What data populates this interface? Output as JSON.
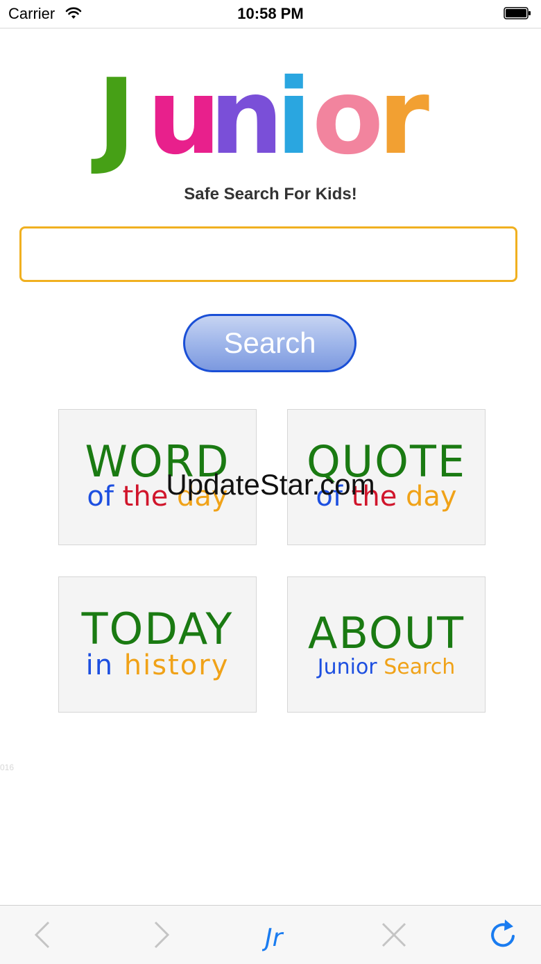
{
  "status_bar": {
    "carrier": "Carrier",
    "time": "10:58 PM"
  },
  "logo": {
    "letters": [
      "J",
      "u",
      "n",
      "i",
      "o",
      "r"
    ],
    "colors": [
      "#46a016",
      "#e8208c",
      "#7a4fd8",
      "#2aa6e0",
      "#f2849e",
      "#f2a032"
    ]
  },
  "tagline": "Safe Search For Kids!",
  "search": {
    "value": "",
    "button_label": "Search"
  },
  "tiles": [
    {
      "big": "WORD",
      "small": [
        "of",
        "the",
        "day"
      ]
    },
    {
      "big": "QUOTE",
      "small": [
        "of",
        "the",
        "day"
      ]
    },
    {
      "big": "TODAY",
      "small": [
        "in",
        "history"
      ]
    },
    {
      "big": "ABOUT",
      "small": [
        "Junior",
        "Search"
      ]
    }
  ],
  "watermark": "UpdateStar.com",
  "faint_text": "016",
  "toolbar": {
    "home_label": "Jr"
  },
  "colors": {
    "accent_border": "#f0b020",
    "button_border": "#1a4fd6",
    "tile_green": "#1a7a12",
    "toolbar_blue": "#1a7cf0"
  }
}
